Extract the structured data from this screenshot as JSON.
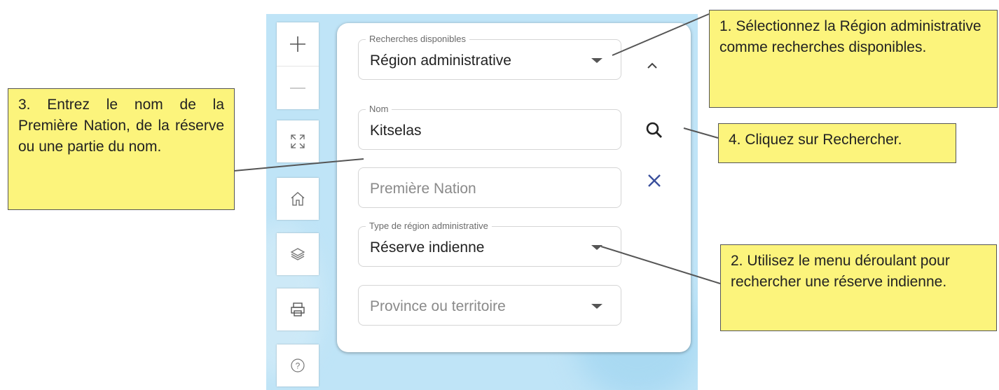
{
  "map_tools": {
    "zoom_in": "zoom-in",
    "zoom_out": "zoom-out",
    "fullscreen": "fullscreen",
    "home": "home",
    "layers": "layers",
    "print": "print",
    "help": "help"
  },
  "search_panel": {
    "available_searches": {
      "legend": "Recherches disponibles",
      "value": "Région administrative"
    },
    "name": {
      "legend": "Nom",
      "value": "Kitselas"
    },
    "first_nation": {
      "placeholder": "Première Nation"
    },
    "admin_region_type": {
      "legend": "Type de région administrative",
      "value": "Réserve indienne"
    },
    "province": {
      "placeholder": "Province ou territoire"
    }
  },
  "callouts": {
    "step1": "1. Sélectionnez la Région administrative comme recherches disponibles.",
    "step2": "2. Utilisez le menu déroulant pour rechercher une réserve indienne.",
    "step3": "3. Entrez le nom de la Première Nation, de la réserve ou une partie du nom.",
    "step4": "4. Cliquez sur Rechercher."
  },
  "colors": {
    "callout_fill": "#fcf47c",
    "map_water": "#bfe4f7",
    "clear_icon": "#3a4f9c"
  }
}
